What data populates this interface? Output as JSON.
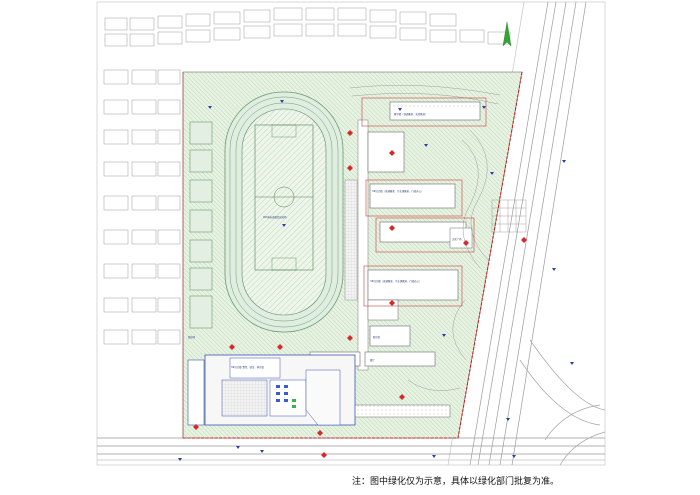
{
  "plan": {
    "labels": {
      "building_1": "教学楼（普通教室、实验教室）",
      "building_2": "3#综合楼（普通教室、专业课教室、行政办公）",
      "building_3": "3#综合楼（普通教室、专业课教室、行政办公）",
      "building_4": "4#综合楼（专业课教室）",
      "canteen": "餐厅",
      "library": "图书馆",
      "plaza": "文化广场",
      "sports_field": "400米标准田径运动场",
      "courts": "篮球场",
      "note_block": "3#综合楼 食堂、宿舍、体育馆"
    }
  },
  "note": "注：图中绿化仅为示意，具体以绿化部门批复为准。"
}
